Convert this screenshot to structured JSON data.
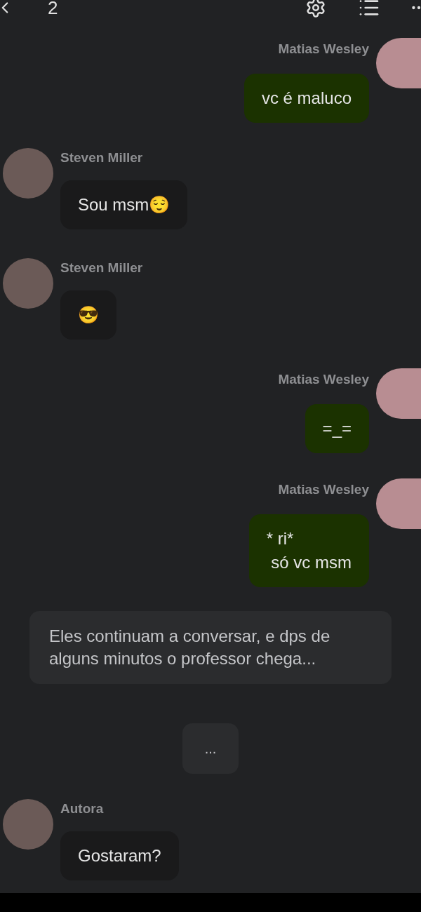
{
  "header": {
    "title": "2"
  },
  "messages": [
    {
      "kind": "right",
      "author": "Matias Wesley",
      "text": "vc é maluco"
    },
    {
      "kind": "left",
      "author": "Steven Miller",
      "text": "Sou msm😌"
    },
    {
      "kind": "left",
      "author": "Steven Miller",
      "text": "😎"
    },
    {
      "kind": "right",
      "author": "Matias Wesley",
      "text": "=_="
    },
    {
      "kind": "right",
      "author": "Matias Wesley",
      "text": "* ri*\n só vc msm"
    },
    {
      "kind": "narration",
      "text": "Eles continuam a conversar, e dps de alguns minutos o professor chega..."
    },
    {
      "kind": "ellipsis",
      "text": "..."
    },
    {
      "kind": "left",
      "author": "Autora",
      "text": "Gostaram?"
    }
  ]
}
